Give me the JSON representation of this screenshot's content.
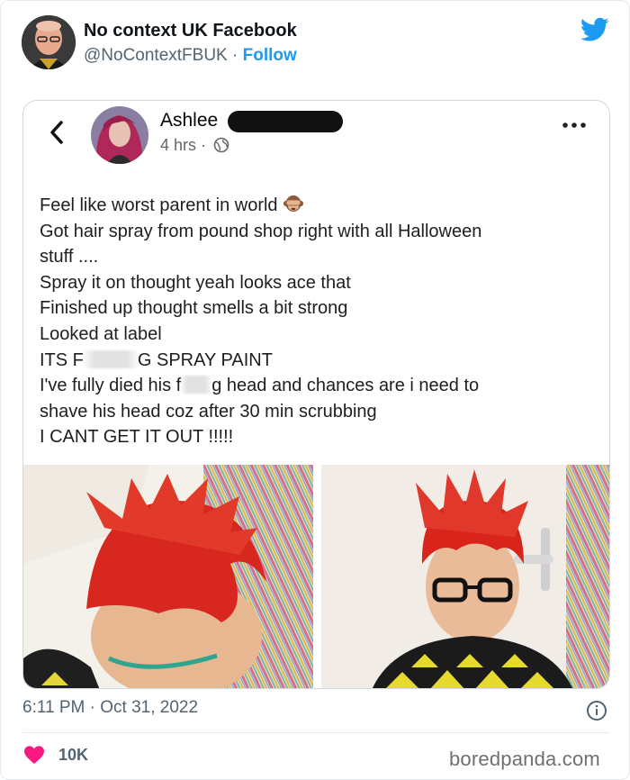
{
  "tweet": {
    "author_name": "No context UK Facebook",
    "handle": "@NoContextFBUK",
    "separator": " · ",
    "follow_label": "Follow",
    "timestamp": "6:11 PM · Oct 31, 2022",
    "likes": "10K",
    "brand_color": "#1d9bf0",
    "like_color": "#f91880"
  },
  "post": {
    "poster_name": "Ashlee",
    "time": "4 hrs",
    "time_separator": " · ",
    "lines": {
      "l1": "Feel like worst parent in world",
      "l2": "Got hair spray from pound shop right with all Halloween",
      "l3": "stuff ....",
      "l4": "Spray it on thought yeah looks ace that",
      "l5": "Finished up thought smells a bit strong",
      "l6": "Looked at label",
      "l7a": "ITS F",
      "l7b": "G SPRAY PAINT",
      "l8a": "I've fully died his f",
      "l8b": "g head and chances are i need to",
      "l9": "shave his head coz after 30 min scrubbing",
      "l10": "I CANT GET IT OUT !!!!!"
    },
    "emoji_name": "see-no-evil-monkey-icon"
  },
  "watermark": "boredpanda.com",
  "icons": [
    "twitter-bird-icon",
    "back-chevron-icon",
    "more-options-icon",
    "globe-icon",
    "info-icon",
    "heart-icon"
  ]
}
